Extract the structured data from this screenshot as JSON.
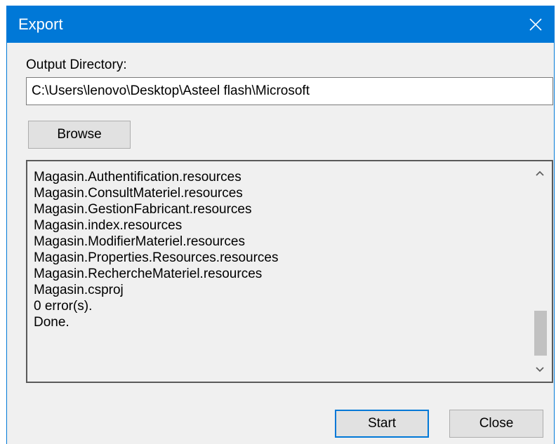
{
  "window": {
    "title": "Export",
    "close_icon": "close-icon"
  },
  "colors": {
    "titlebar": "#0078d7",
    "dialog_bg": "#f0f0f0",
    "button_bg": "#e1e1e1",
    "default_button_border": "#0078d7"
  },
  "output": {
    "label": "Output Directory:",
    "value": "C:\\Users\\lenovo\\Desktop\\Asteel flash\\Microsoft"
  },
  "browse_label": "Browse",
  "log": {
    "lines": [
      "Magasin.Authentification.resources",
      "Magasin.ConsultMateriel.resources",
      "Magasin.GestionFabricant.resources",
      "Magasin.index.resources",
      "Magasin.ModifierMateriel.resources",
      "Magasin.Properties.Resources.resources",
      "Magasin.RechercheMateriel.resources",
      "Magasin.csproj",
      "0 error(s).",
      "Done."
    ],
    "scroll_up_icon": "chevron-up-icon",
    "scroll_down_icon": "chevron-down-icon"
  },
  "buttons": {
    "start_label": "Start",
    "close_label": "Close"
  }
}
